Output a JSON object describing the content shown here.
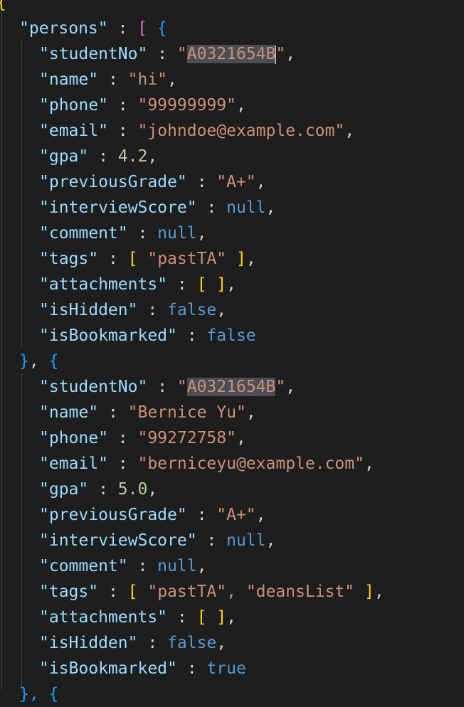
{
  "editor": {
    "open_brace": "{",
    "persons_key": "\"persons\"",
    "colon": " : ",
    "open_array": "[",
    "open_obj": "{",
    "records": [
      {
        "studentNo_key": "\"studentNo\"",
        "studentNo_q1": "\"",
        "studentNo_val": "A0321654B",
        "studentNo_q2": "\"",
        "name_key": "\"name\"",
        "name_val": "\"hi\"",
        "phone_key": "\"phone\"",
        "phone_val": "\"99999999\"",
        "email_key": "\"email\"",
        "email_val": "\"johndoe@example.com\"",
        "gpa_key": "\"gpa\"",
        "gpa_val": "4.2",
        "previousGrade_key": "\"previousGrade\"",
        "previousGrade_val": "\"A+\"",
        "interviewScore_key": "\"interviewScore\"",
        "interviewScore_val": "null",
        "comment_key": "\"comment\"",
        "comment_val": "null",
        "tags_key": "\"tags\"",
        "tags_open": "[",
        "tags_items": " \"pastTA\" ",
        "tags_close": "]",
        "attachments_key": "\"attachments\"",
        "attachments_open": "[",
        "attachments_space": " ",
        "attachments_close": "]",
        "isHidden_key": "\"isHidden\"",
        "isHidden_val": "false",
        "isBookmarked_key": "\"isBookmarked\"",
        "isBookmarked_val": "false"
      },
      {
        "studentNo_key": "\"studentNo\"",
        "studentNo_q1": "\"",
        "studentNo_val": "A0321654B",
        "studentNo_q2": "\"",
        "name_key": "\"name\"",
        "name_val": "\"Bernice Yu\"",
        "phone_key": "\"phone\"",
        "phone_val": "\"99272758\"",
        "email_key": "\"email\"",
        "email_val": "\"berniceyu@example.com\"",
        "gpa_key": "\"gpa\"",
        "gpa_val": "5.0",
        "previousGrade_key": "\"previousGrade\"",
        "previousGrade_val": "\"A+\"",
        "interviewScore_key": "\"interviewScore\"",
        "interviewScore_val": "null",
        "comment_key": "\"comment\"",
        "comment_val": "null",
        "tags_key": "\"tags\"",
        "tags_open": "[",
        "tags_items": " \"pastTA\", \"deansList\" ",
        "tags_close": "]",
        "attachments_key": "\"attachments\"",
        "attachments_open": "[",
        "attachments_space": " ",
        "attachments_close": "]",
        "isHidden_key": "\"isHidden\"",
        "isHidden_val": "false",
        "isBookmarked_key": "\"isBookmarked\"",
        "isBookmarked_val": "true"
      }
    ],
    "separator_close": "}",
    "separator_mid": ", ",
    "separator_open": "{",
    "bottom_partial": "}, {",
    "comma": ","
  }
}
